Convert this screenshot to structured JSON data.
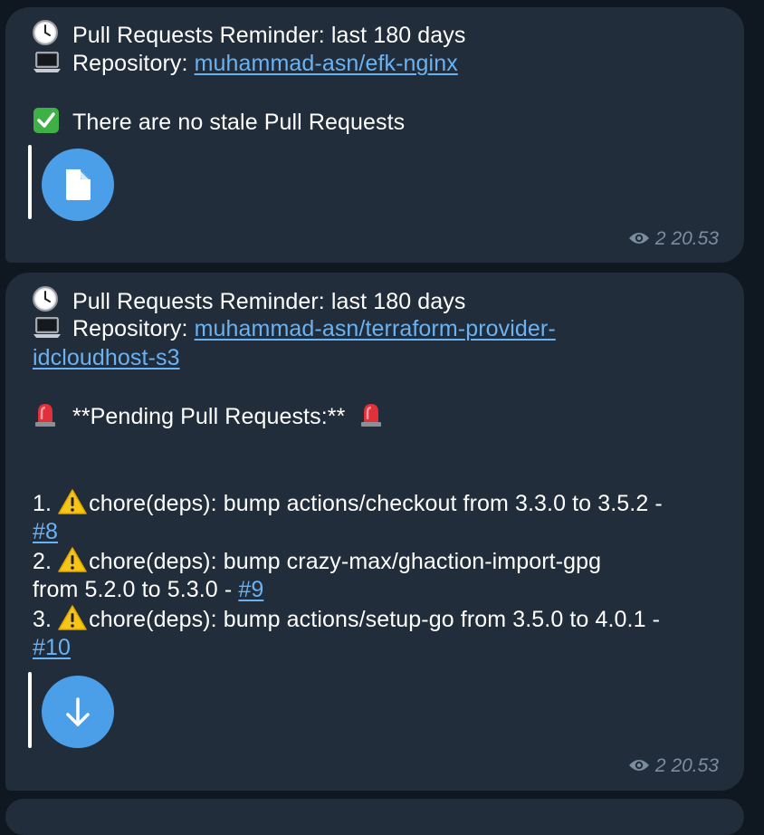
{
  "messages": [
    {
      "header_line1": "Pull Requests Reminder: last 180 days",
      "repo_label": "Repository: ",
      "repo_link": "muhammad-asn/efk-nginx",
      "status": "There are no stale Pull Requests",
      "attachment_icon": "file-icon",
      "views": "2",
      "time": "20.53"
    },
    {
      "header_line1": "Pull Requests Reminder: last 180 days",
      "repo_label": "Repository: ",
      "repo_link_part1": "muhammad-asn/terraform-provider-",
      "repo_link_part2": "idcloudhost-s3",
      "pending_title": "**Pending Pull Requests:**",
      "items": [
        {
          "num": "1.",
          "text_line1": "chore(deps): bump actions/checkout from 3.3.0 to 3.5.2 -",
          "link": "#8"
        },
        {
          "num": "2.",
          "text_line1": "chore(deps): bump crazy-max/ghaction-import-gpg",
          "text_line2": "from 5.2.0 to 5.3.0 - ",
          "link": "#9"
        },
        {
          "num": "3.",
          "text_line1": "chore(deps): bump actions/setup-go from 3.5.0 to 4.0.1 -",
          "link": "#10"
        }
      ],
      "attachment_icon": "download-arrow-icon",
      "views": "2",
      "time": "20.53"
    }
  ],
  "colors": {
    "background": "#0f1721",
    "bubble": "#212d3b",
    "link": "#6ab2f2",
    "button": "#4a9fe8",
    "meta": "#7b8d9e"
  }
}
